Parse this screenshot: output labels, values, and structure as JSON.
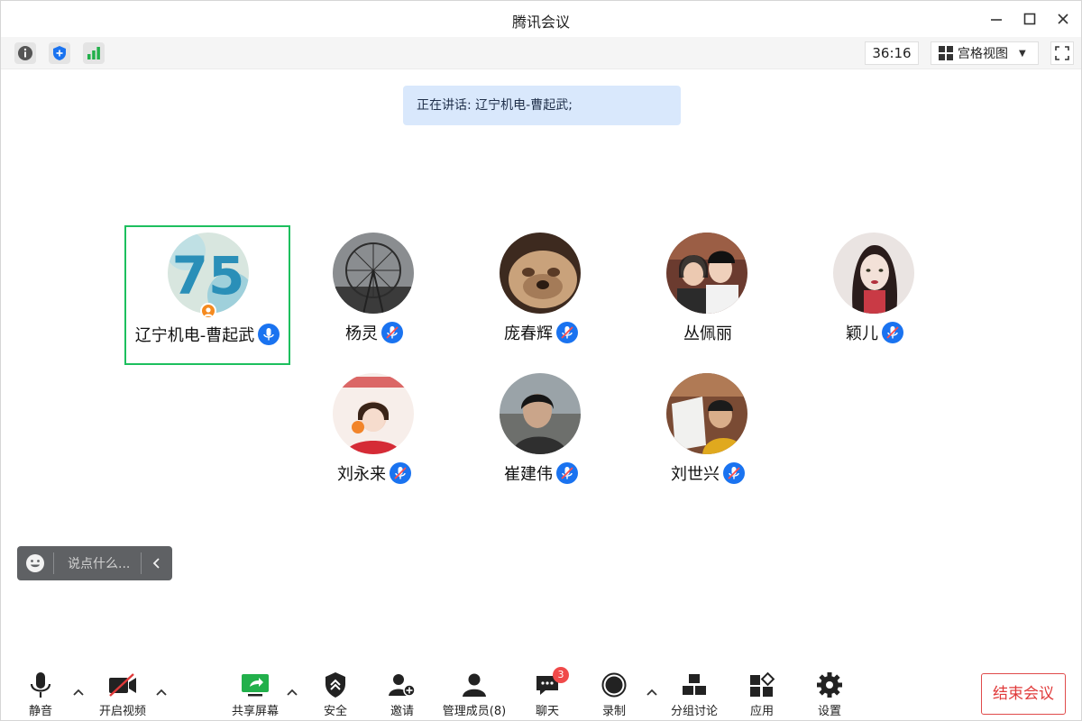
{
  "window": {
    "title": "腾讯会议"
  },
  "top_toolbar": {
    "timer": "36:16",
    "view_mode": "宫格视图"
  },
  "speaking_banner": "正在讲话: 辽宁机电-曹起武;",
  "participants": [
    {
      "name": "辽宁机电-曹起武",
      "mic": "on",
      "host": true,
      "active": true,
      "avatar": "blue-75-art"
    },
    {
      "name": "杨灵",
      "mic": "muted",
      "avatar": "ferris-wheel"
    },
    {
      "name": "庞春辉",
      "mic": "muted",
      "avatar": "bulldog"
    },
    {
      "name": "丛佩丽",
      "mic": "none",
      "avatar": "two-women"
    },
    {
      "name": "颖儿",
      "mic": "muted",
      "avatar": "illustrated-girl"
    },
    {
      "name": "刘永来",
      "mic": "muted",
      "avatar": "girl-with-orange"
    },
    {
      "name": "崔建伟",
      "mic": "muted",
      "avatar": "man-portrait"
    },
    {
      "name": "刘世兴",
      "mic": "muted",
      "avatar": "boy-reading"
    }
  ],
  "chat": {
    "placeholder": "说点什么..."
  },
  "bottom_toolbar": {
    "mute": "静音",
    "video": "开启视频",
    "share": "共享屏幕",
    "security": "安全",
    "invite": "邀请",
    "members": "管理成员(8)",
    "chat": "聊天",
    "chat_badge": "3",
    "record": "录制",
    "breakout": "分组讨论",
    "apps": "应用",
    "settings": "设置",
    "end": "结束会议"
  },
  "colors": {
    "active_border": "#1dbf5e",
    "mic_blue": "#1a73f0",
    "end_red": "#e03a3a",
    "banner_bg": "#d9e8fc"
  }
}
